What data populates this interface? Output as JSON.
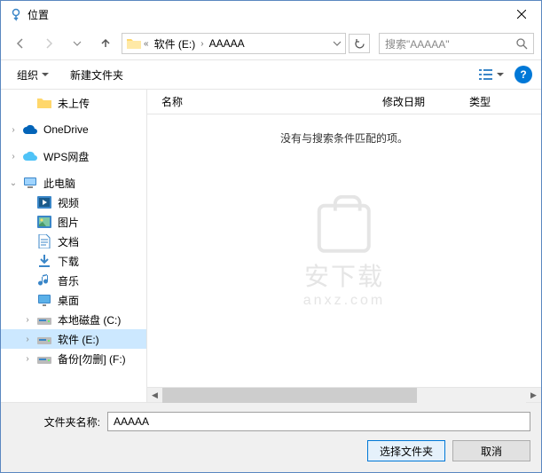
{
  "window": {
    "title": "位置"
  },
  "address": {
    "prefix": "«",
    "crumb1": "软件 (E:)",
    "crumb2": "AAAAA"
  },
  "search": {
    "placeholder": "搜索\"AAAAA\""
  },
  "toolbar": {
    "organize": "组织",
    "newfolder": "新建文件夹"
  },
  "columns": {
    "name": "名称",
    "modified": "修改日期",
    "type": "类型"
  },
  "empty_msg": "没有与搜索条件匹配的项。",
  "tree": {
    "notuploaded": "未上传",
    "onedrive": "OneDrive",
    "wps": "WPS网盘",
    "thispc": "此电脑",
    "video": "视频",
    "pictures": "图片",
    "documents": "文档",
    "downloads": "下载",
    "music": "音乐",
    "desktop": "桌面",
    "localc": "本地磁盘 (C:)",
    "softe": "软件 (E:)",
    "backupf": "备份[勿删] (F:)"
  },
  "footer": {
    "label": "文件夹名称:",
    "value": "AAAAA",
    "select": "选择文件夹",
    "cancel": "取消"
  }
}
